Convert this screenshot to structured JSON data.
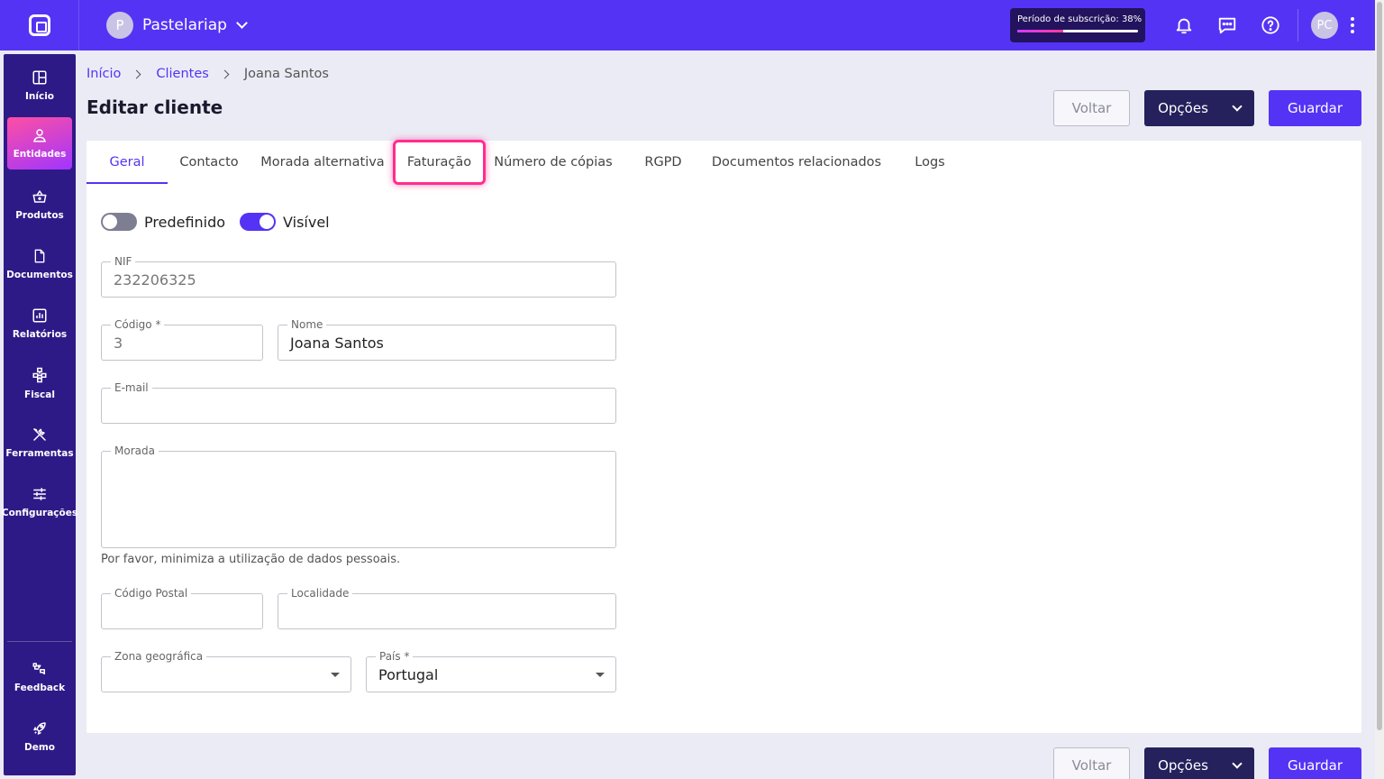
{
  "header": {
    "company_initial": "P",
    "company_name": "Pastelariap",
    "subscription_text": "Período de subscrição: 38%",
    "subscription_progress_percent": 38,
    "user_initials": "PC",
    "icons": [
      "bell-icon",
      "chat-icon",
      "help-icon",
      "kebab-menu-icon"
    ]
  },
  "sidebar": {
    "items": [
      {
        "label": "Início",
        "icon": "dashboard-icon"
      },
      {
        "label": "Entidades",
        "icon": "person-icon",
        "active": true
      },
      {
        "label": "Produtos",
        "icon": "basket-icon"
      },
      {
        "label": "Documentos",
        "icon": "document-icon"
      },
      {
        "label": "Relatórios",
        "icon": "chart-icon"
      },
      {
        "label": "Fiscal",
        "icon": "hierarchy-icon"
      },
      {
        "label": "Ferramentas",
        "icon": "tools-icon"
      },
      {
        "label": "Configurações",
        "icon": "sliders-icon"
      },
      {
        "label": "Feedback",
        "icon": "feedback-icon"
      },
      {
        "label": "Demo",
        "icon": "rocket-icon"
      }
    ]
  },
  "breadcrumb": [
    "Início",
    "Clientes",
    "Joana Santos"
  ],
  "page": {
    "title": "Editar cliente",
    "buttons": {
      "back": "Voltar",
      "options": "Opções",
      "save": "Guardar"
    }
  },
  "tabs": [
    "Geral",
    "Contacto",
    "Morada alternativa",
    "Faturação",
    "Número de cópias",
    "RGPD",
    "Documentos relacionados",
    "Logs"
  ],
  "active_tab": "Geral",
  "highlighted_tab": "Faturação",
  "toggles": {
    "default": {
      "label": "Predefinido",
      "on": false
    },
    "visible": {
      "label": "Visível",
      "on": true
    }
  },
  "form": {
    "nif": {
      "label": "NIF",
      "value": "232206325"
    },
    "code": {
      "label": "Código *",
      "value": "3"
    },
    "name": {
      "label": "Nome",
      "value": "Joana Santos"
    },
    "email": {
      "label": "E-mail",
      "value": ""
    },
    "address": {
      "label": "Morada",
      "value": ""
    },
    "privacy_hint": "Por favor, minimiza a utilização de dados pessoais.",
    "postal_code": {
      "label": "Código Postal",
      "value": ""
    },
    "locality": {
      "label": "Localidade",
      "value": ""
    },
    "zone": {
      "label": "Zona geográfica",
      "value": ""
    },
    "country": {
      "label": "País *",
      "value": "Portugal"
    }
  },
  "colors": {
    "accent": "#5533f5",
    "sidebar": "#2e1a87",
    "dark_button": "#25215c",
    "highlight": "#ff2d8d"
  }
}
